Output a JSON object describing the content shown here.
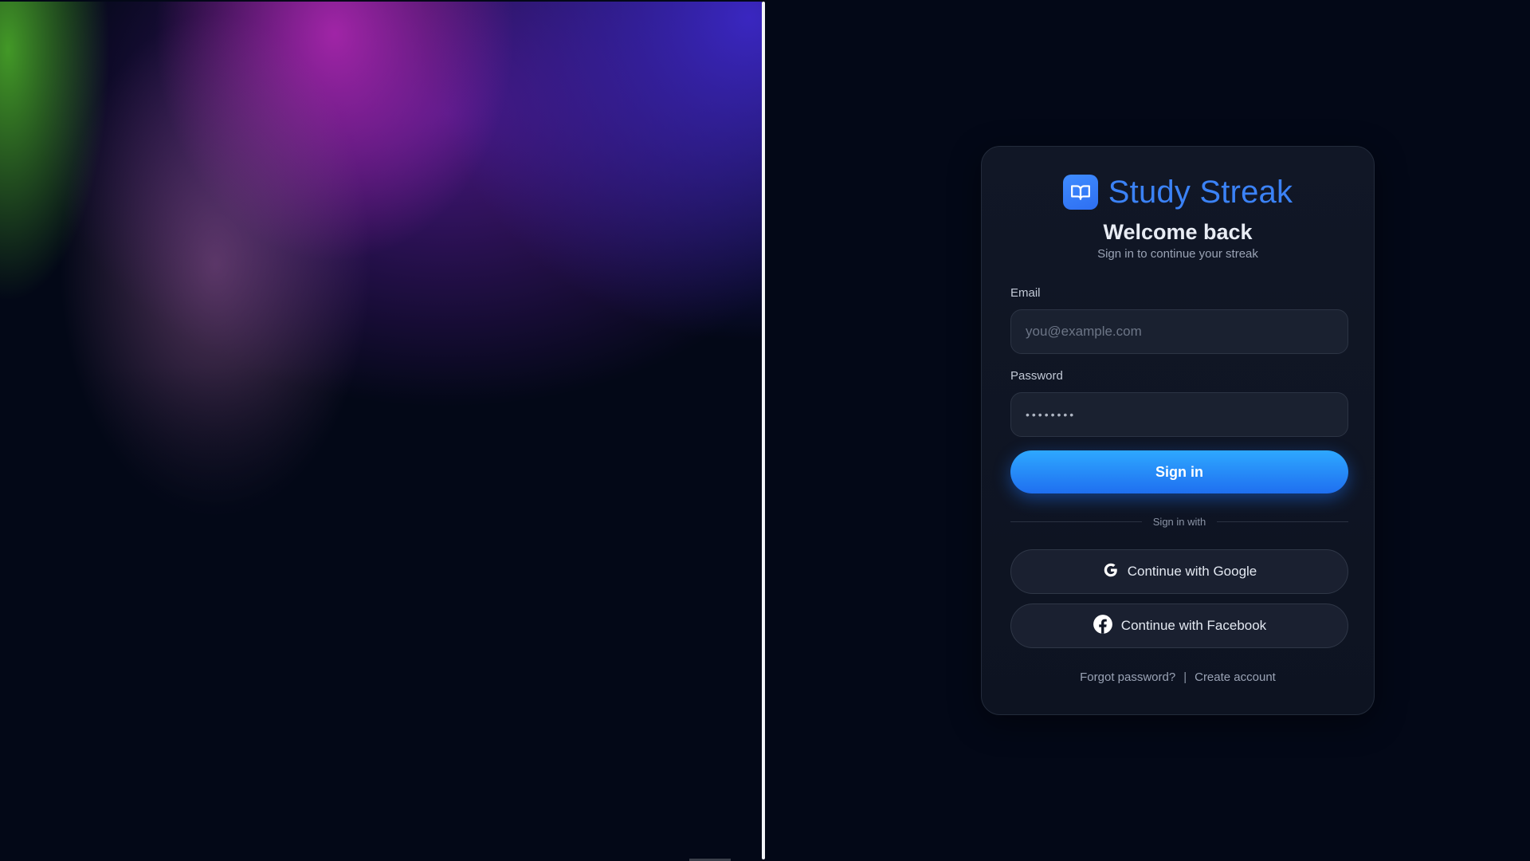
{
  "app": {
    "brand_name": "Study Streak",
    "logo_icon": "open-book-icon"
  },
  "login": {
    "title": "Welcome back",
    "subtitle": "Sign in to continue your streak",
    "email": {
      "label": "Email",
      "placeholder": "you@example.com",
      "value": ""
    },
    "password": {
      "label": "Password",
      "value": "••••••••"
    },
    "signin_label": "Sign in",
    "separator_text": "Sign in with",
    "google_label": "Continue with Google",
    "facebook_label": "Continue with Facebook",
    "forgot_label": "Forgot password?",
    "link_separator": "|",
    "create_label": "Create account"
  },
  "colors": {
    "background": "#030817",
    "brand_blue": "#3b82f6",
    "card": "#111726",
    "button_gradient_top": "#2ea8ff",
    "button_gradient_bottom": "#1f6ff0"
  }
}
